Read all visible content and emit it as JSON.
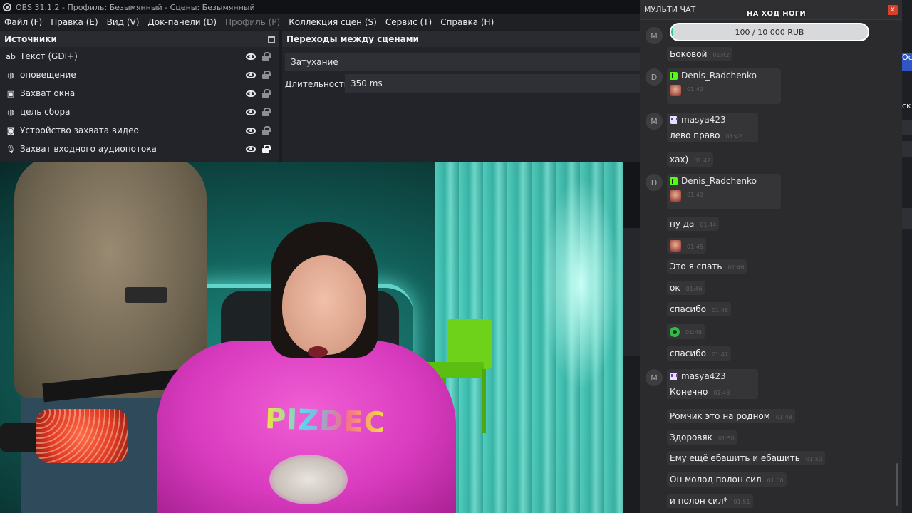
{
  "window": {
    "title": "OBS 31.1.2 - Профиль: Безымянный - Сцены: Безымянный"
  },
  "menu": {
    "items": [
      {
        "label": "Файл (F)",
        "disabled": false
      },
      {
        "label": "Правка (E)",
        "disabled": false
      },
      {
        "label": "Вид (V)",
        "disabled": false
      },
      {
        "label": "Док-панели (D)",
        "disabled": false
      },
      {
        "label": "Профиль (P)",
        "disabled": true
      },
      {
        "label": "Коллекция сцен (S)",
        "disabled": false
      },
      {
        "label": "Сервис (T)",
        "disabled": false
      },
      {
        "label": "Справка (H)",
        "disabled": false
      }
    ]
  },
  "sources": {
    "title": "Источники",
    "items": [
      {
        "label": "Текст (GDI+)",
        "icon": "text-icon",
        "visible": true,
        "locked": false
      },
      {
        "label": "оповещение",
        "icon": "globe-icon",
        "visible": true,
        "locked": false
      },
      {
        "label": "Захват окна",
        "icon": "window-icon",
        "visible": true,
        "locked": false
      },
      {
        "label": "цель сбора",
        "icon": "globe-icon",
        "visible": true,
        "locked": false
      },
      {
        "label": "Устройство захвата видео",
        "icon": "camera-icon",
        "visible": true,
        "locked": false
      },
      {
        "label": "Захват входного аудиопотока",
        "icon": "microphone-icon",
        "visible": true,
        "locked": true
      }
    ]
  },
  "transitions": {
    "title": "Переходы между сценами",
    "selected": "Затухание",
    "duration_label": "Длительность",
    "duration_value": "350 ms"
  },
  "right_panel": {
    "button_text": "Ос",
    "partial_text": "ск"
  },
  "shirt": {
    "text": "PIZDEC"
  },
  "chat": {
    "title": "МУЛЬТИ ЧАТ",
    "close_label": "x",
    "goal": {
      "title": "НА ХОД НОГИ",
      "progress_text": "100 / 10 000 RUB",
      "fraction": 0.01
    },
    "messages": [
      {
        "text": "Боковой",
        "time": "01:42"
      },
      {
        "avatar": "D",
        "user": "Denis_Radchenko",
        "platform": "kick",
        "time": "01:42"
      },
      {
        "avatar": "M",
        "user": "masya423",
        "platform": "twitch",
        "text": "лево право",
        "time": "01:42"
      },
      {
        "text": "хах)",
        "time": "01:42"
      },
      {
        "avatar": "D",
        "user": "Denis_Radchenko",
        "platform": "kick",
        "time": "01:43"
      },
      {
        "text": "ну да",
        "time": "01:44"
      },
      {
        "time": "01:45"
      },
      {
        "text": "Это я  спать",
        "time": "01:46"
      },
      {
        "text": "ок",
        "time": "01:46"
      },
      {
        "text": "спасибо",
        "time": "01:46"
      },
      {
        "time": "01:46"
      },
      {
        "text": "спасибо",
        "time": "01:47"
      },
      {
        "avatar": "M",
        "user": "masya423",
        "platform": "twitch",
        "text": "Конечно",
        "time": "01:48"
      },
      {
        "text": "Ромчик это на родном",
        "time": "01:48"
      },
      {
        "text": "Здоровяк",
        "time": "01:50"
      },
      {
        "text": "Ему ещё ебашить и ебашить",
        "time": "01:50"
      },
      {
        "text": "Он молод полон сил",
        "time": "01:50"
      },
      {
        "text": "и полон сил*",
        "time": "01:51"
      }
    ],
    "first_avatar": "M"
  }
}
